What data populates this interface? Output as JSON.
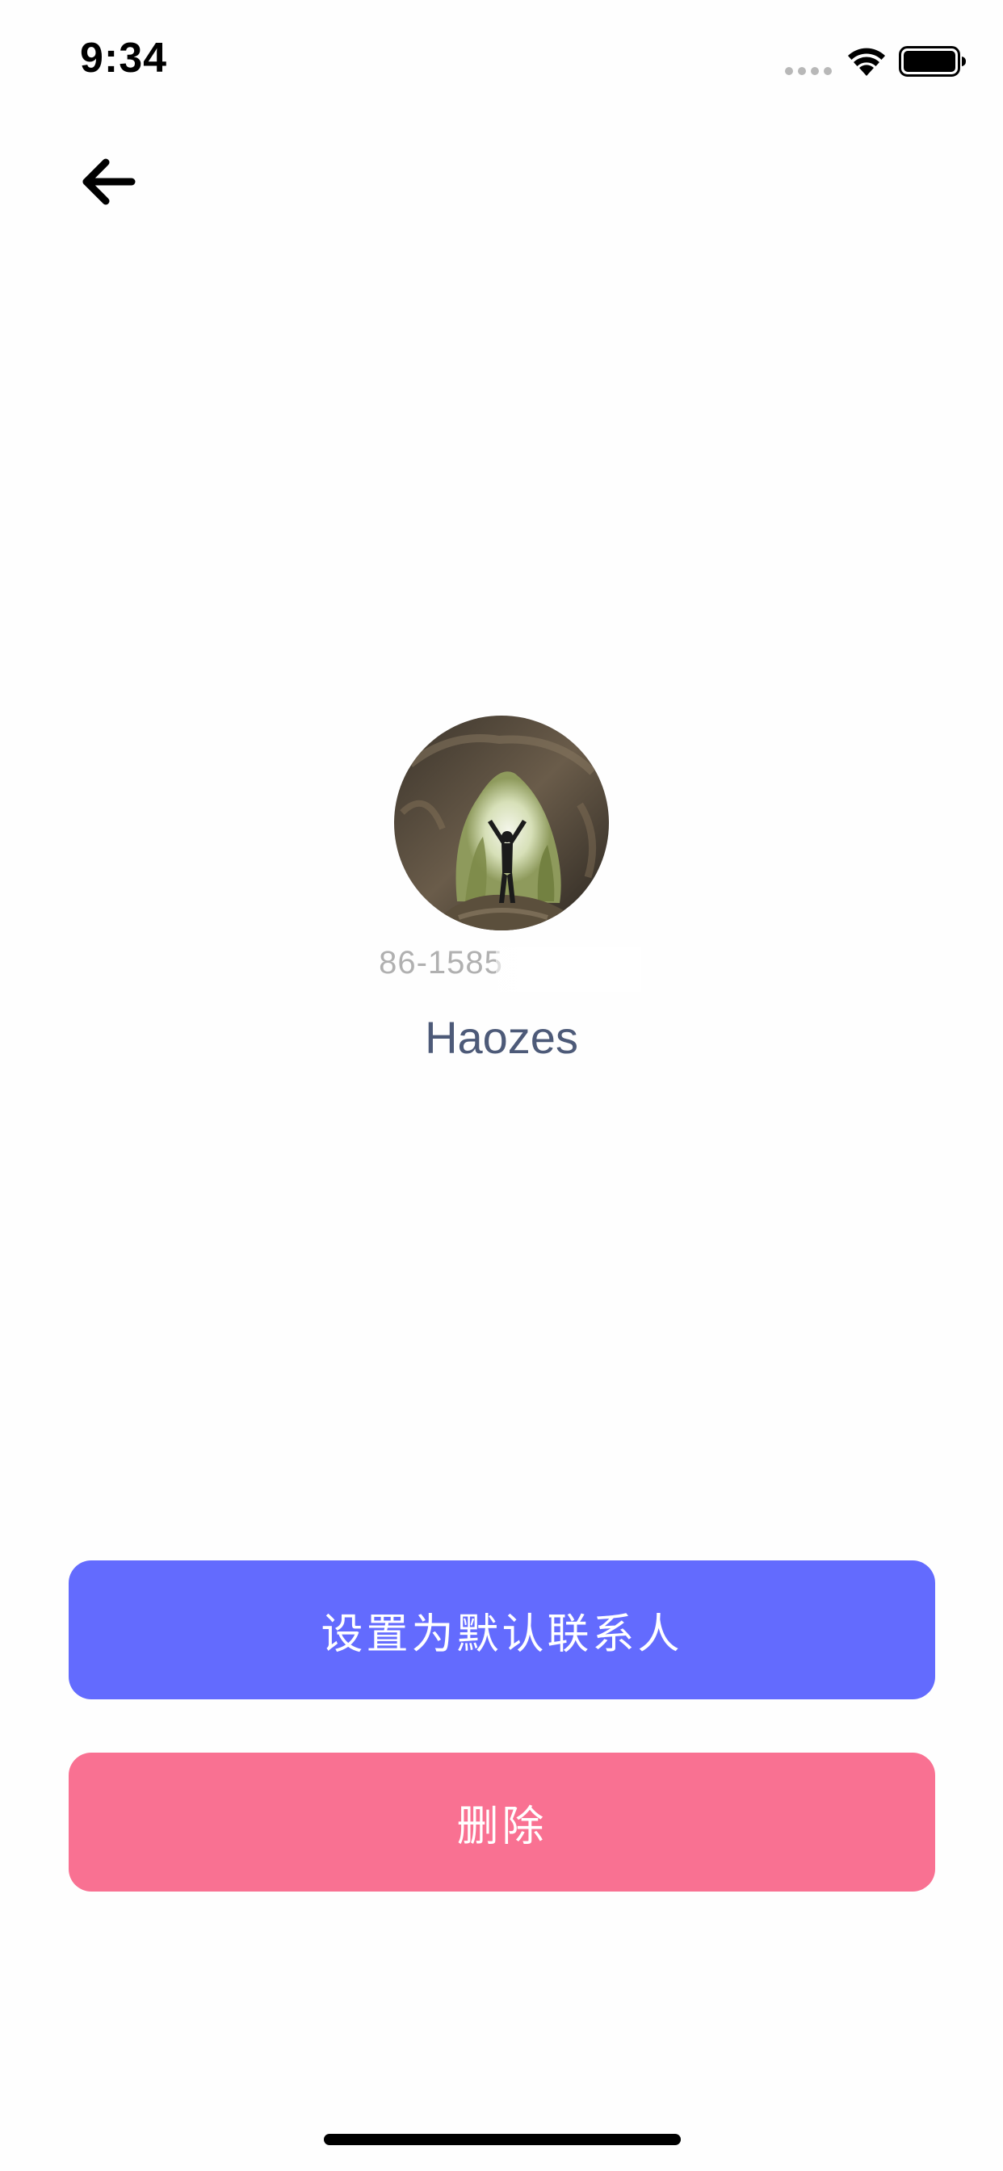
{
  "status_bar": {
    "time": "9:34"
  },
  "nav": {
    "back_icon": "arrow-left-icon"
  },
  "profile": {
    "phone": "86-1585",
    "name": "Haozes"
  },
  "actions": {
    "set_default_label": "设置为默认联系人",
    "delete_label": "删除"
  },
  "colors": {
    "primary": "#636bfe",
    "danger": "#f97192",
    "name_text": "#4d5a78",
    "phone_text": "#b0b0b0"
  }
}
